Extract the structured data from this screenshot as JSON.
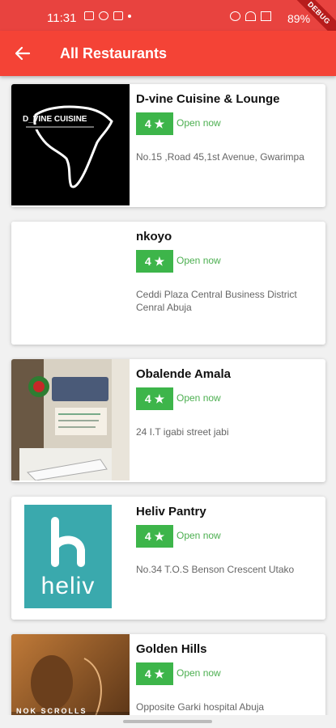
{
  "status_bar": {
    "time": "11:31",
    "battery": "89%",
    "debug_label": "DEBUG"
  },
  "app_bar": {
    "title": "All Restaurants",
    "back_icon": "arrow-left-icon"
  },
  "colors": {
    "accent": "#f44336",
    "rating_green": "#3db54a",
    "open_green": "#4caf50"
  },
  "restaurants": [
    {
      "name": "D-vine Cuisine & Lounge",
      "rating": "4",
      "status": "Open now",
      "address": "No.15 ,Road 45,1st Avenue, Gwarimpa",
      "logo_text": "D_VINE CUISINE"
    },
    {
      "name": "nkoyo",
      "rating": "4",
      "status": "Open now",
      "address": "Ceddi Plaza Central Business District Cenral Abuja"
    },
    {
      "name": "Obalende Amala",
      "rating": "4",
      "status": "Open now",
      "address": "24 I.T igabi street jabi"
    },
    {
      "name": "Heliv Pantry",
      "rating": "4",
      "status": "Open now",
      "address": "No.34 T.O.S Benson Crescent Utako",
      "logo_text": "heliv"
    },
    {
      "name": "Golden Hills",
      "rating": "4",
      "status": "Open now",
      "address": "Opposite Garki hospital Abuja",
      "logo_text": "NOK SCROLLS"
    }
  ]
}
